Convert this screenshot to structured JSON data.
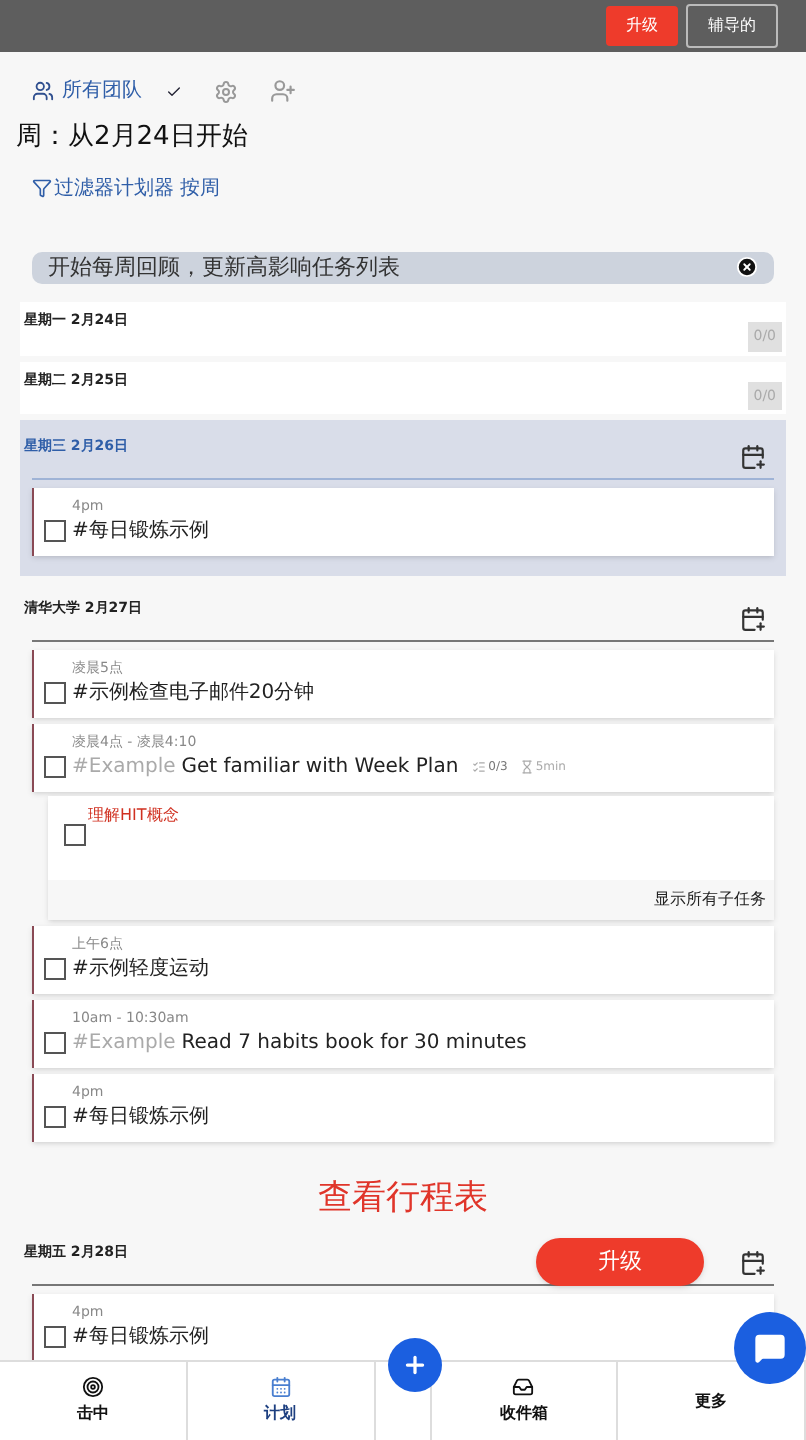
{
  "top_bar": {
    "buttons": [
      {
        "label": "升级",
        "kind": "primary"
      },
      {
        "label": "辅导的",
        "kind": "outline"
      }
    ]
  },
  "header": {
    "team": "所有团队",
    "week_title": "周：从2月24日开始",
    "filter": "过滤器计划器 按周"
  },
  "banner": {
    "text": "开始每周回顾，更新高影响任务列表"
  },
  "days": [
    {
      "label": "星期一 2月24日",
      "selected": false,
      "expanded": false,
      "count": "0/0"
    },
    {
      "label": "星期二 2月25日",
      "selected": false,
      "expanded": false,
      "count": "0/0"
    },
    {
      "label": "星期三 2月26日",
      "selected": true,
      "expanded": true,
      "tasks": [
        {
          "time": "4pm",
          "title": "#每日锻炼示例",
          "checked": false
        }
      ]
    },
    {
      "label": "清华大学 2月27日",
      "selected": false,
      "expanded": true,
      "tasks": [
        {
          "time": "凌晨5点",
          "title": "#示例检查电子邮件20分钟",
          "checked": false
        },
        {
          "time": "凌晨4点 - 凌晨4:10",
          "tag": "#Example",
          "title": "Get familiar with Week Plan",
          "subtask_count": "0/3",
          "duration": "5min",
          "checked": false,
          "subtasks": [
            {
              "title": "理解HIT概念",
              "checked": false
            }
          ],
          "show_all": "显示所有子任务"
        },
        {
          "time": "上午6点",
          "title": "#示例轻度运动",
          "checked": false
        },
        {
          "time": "10am - 10:30am",
          "tag": "#Example",
          "title": "Read 7 habits book for 30 minutes",
          "checked": false
        },
        {
          "time": "4pm",
          "title": "#每日锻炼示例",
          "checked": false
        }
      ]
    },
    {
      "label": "星期五 2月28日",
      "selected": false,
      "expanded": true,
      "tasks": [
        {
          "time": "4pm",
          "title": "#每日锻炼示例",
          "checked": false
        }
      ]
    }
  ],
  "schedule_link": "查看行程表",
  "floating_upgrade": "升级",
  "bottom_nav": [
    {
      "label": "击中",
      "selected": false
    },
    {
      "label": "计划",
      "selected": true
    },
    {
      "label": "收件箱",
      "selected": false
    },
    {
      "label": "更多",
      "selected": false
    }
  ]
}
